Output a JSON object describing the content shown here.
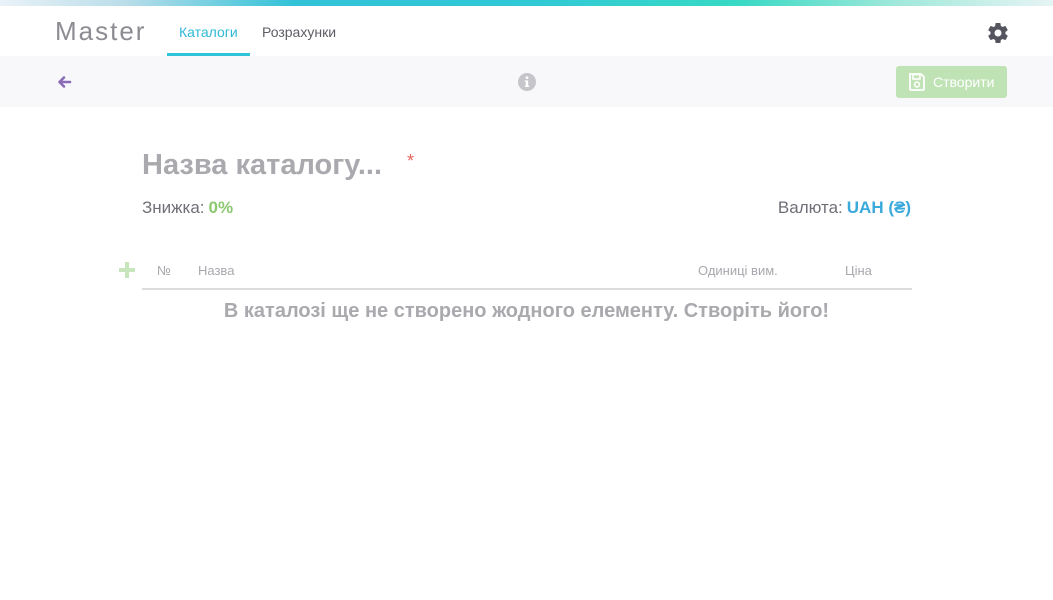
{
  "app": {
    "brand": "Master"
  },
  "nav": {
    "tabs": [
      {
        "label": "Каталоги",
        "active": true
      },
      {
        "label": "Розрахунки",
        "active": false
      }
    ]
  },
  "toolbar": {
    "create_label": "Створити"
  },
  "catalog": {
    "title_placeholder": "Назва каталогу...",
    "required_mark": "*",
    "discount_label": "Знижка:",
    "discount_value": "0%",
    "currency_label": "Валюта:",
    "currency_value": "UAH (₴)"
  },
  "table": {
    "columns": [
      "№",
      "Назва",
      "Одиниці вим.",
      "Ціна"
    ],
    "empty_message": "В каталозі ще не створено жодного елементу. Створіть його!"
  },
  "colors": {
    "accent": "#2fc4d8",
    "create_button": "#bfe3b4",
    "discount": "#8cc86f",
    "currency": "#3aa9db",
    "required": "#e0675b"
  },
  "icons": [
    "gear-icon",
    "back-arrow-icon",
    "info-icon",
    "save-icon",
    "plus-icon"
  ]
}
